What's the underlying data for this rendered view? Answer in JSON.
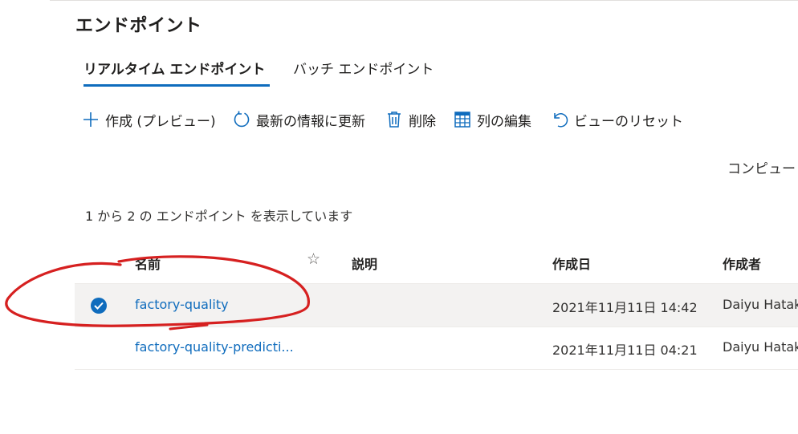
{
  "page": {
    "title": "エンドポイント"
  },
  "tabs": [
    {
      "label": "リアルタイム エンドポイント",
      "active": true
    },
    {
      "label": "バッチ エンドポイント",
      "active": false
    }
  ],
  "toolbar": {
    "create_label": "作成 (プレビュー)",
    "refresh_label": "最新の情報に更新",
    "delete_label": "削除",
    "edit_columns_label": "列の編集",
    "reset_view_label": "ビューのリセット"
  },
  "compute_label": "コンピュー",
  "count_text": "1 から 2 の エンドポイント を表示しています",
  "table": {
    "headers": {
      "name": "名前",
      "star": "☆",
      "description": "説明",
      "created_on": "作成日",
      "created_by": "作成者"
    },
    "rows": [
      {
        "name": "factory-quality",
        "description": "",
        "created_on": "2021年11月11日 14:42",
        "created_by": "Daiyu Hatake",
        "selected": true
      },
      {
        "name": "factory-quality-predicti...",
        "description": "",
        "created_on": "2021年11月11日 04:21",
        "created_by": "Daiyu Hatake",
        "selected": false
      }
    ]
  },
  "colors": {
    "accent": "#0f6cbd",
    "annotation": "#d62020",
    "selected_row": "#f3f2f1"
  },
  "icons": {
    "create": "plus-icon",
    "refresh": "refresh-icon",
    "delete": "trash-icon",
    "edit_columns": "table-columns-icon",
    "reset_view": "undo-icon",
    "selected": "check-circle-icon",
    "favorite": "star-outline-icon"
  }
}
